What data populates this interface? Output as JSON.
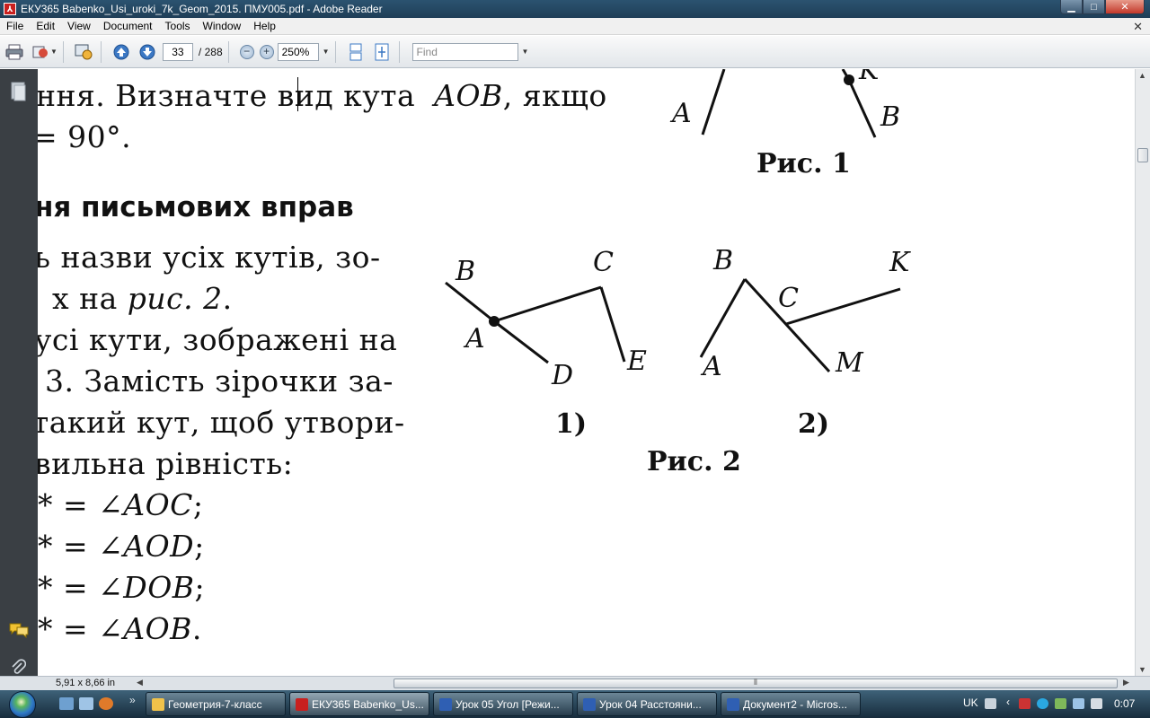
{
  "window": {
    "title": "ЕКУ365 Babenko_Usi_uroki_7k_Geom_2015. ПМУ005.pdf - Adobe Reader",
    "min_glyph": "▁",
    "max_glyph": "□",
    "close_glyph": "✕"
  },
  "menu": {
    "items": [
      "File",
      "Edit",
      "View",
      "Document",
      "Tools",
      "Window",
      "Help"
    ],
    "close_glyph": "✕"
  },
  "toolbar": {
    "current_page": "33",
    "total_pages": "/ 288",
    "zoom": "250%",
    "find_placeholder": "Find"
  },
  "document": {
    "line1_a": "ння. Визначте в",
    "line1_b": "ид кута ",
    "line1_aob": "AOB",
    "line1_c": ", якщо",
    "line2": "= 90°.",
    "heading": "ня письмових вправ",
    "ex1_line1": "ь назви усіх кутів, зо-",
    "ex1_line2_a": "х на ",
    "ex1_line2_fig": "рис. 2",
    "ex1_line2_b": ".",
    "ex2_line1": "усі кути, зображені на",
    "ex2_line2": "3. Замість зірочки за-",
    "ex2_line3": "такий кут, щоб утвори-",
    "ex2_line4": "вильна рівність:",
    "eq1_a": "* = ∠",
    "eq1_b": "AOC",
    "eq1_c": ";",
    "eq2_a": "* = ∠",
    "eq2_b": "AOD",
    "eq2_c": ";",
    "eq3_a": "* = ∠",
    "eq3_b": "DOB",
    "eq3_c": ";",
    "eq4_a": "* = ∠",
    "eq4_b": "AOB",
    "eq4_c": ".",
    "fig1": {
      "labels": {
        "A": "A",
        "K": "K",
        "B": "B"
      },
      "caption": "Рис. 1"
    },
    "fig2": {
      "part1": {
        "B": "B",
        "C": "C",
        "A": "A",
        "D": "D",
        "E": "E",
        "caption": "1)"
      },
      "part2": {
        "B": "B",
        "K": "K",
        "C": "C",
        "A": "A",
        "M": "M",
        "caption": "2)"
      },
      "caption": "Рис. 2"
    }
  },
  "status": {
    "page_size": "5,91 x 8,66 in"
  },
  "taskbar": {
    "tasks": [
      {
        "label": "Геометрия-7-класс",
        "active": false
      },
      {
        "label": "ЕКУ365 Babenko_Us...",
        "active": true
      },
      {
        "label": "Урок 05 Угол [Режи...",
        "active": false
      },
      {
        "label": "Урок 04 Расстояни...",
        "active": false
      },
      {
        "label": "Документ2 - Micros...",
        "active": false
      }
    ],
    "more_glyph": "»",
    "language": "UK",
    "clock": "0:07"
  },
  "colors": {
    "title_bar": "#1f3e57",
    "left_panel": "#3a3f44",
    "taskbar": "#172c3c",
    "pdf_icon": "#c8201f"
  }
}
